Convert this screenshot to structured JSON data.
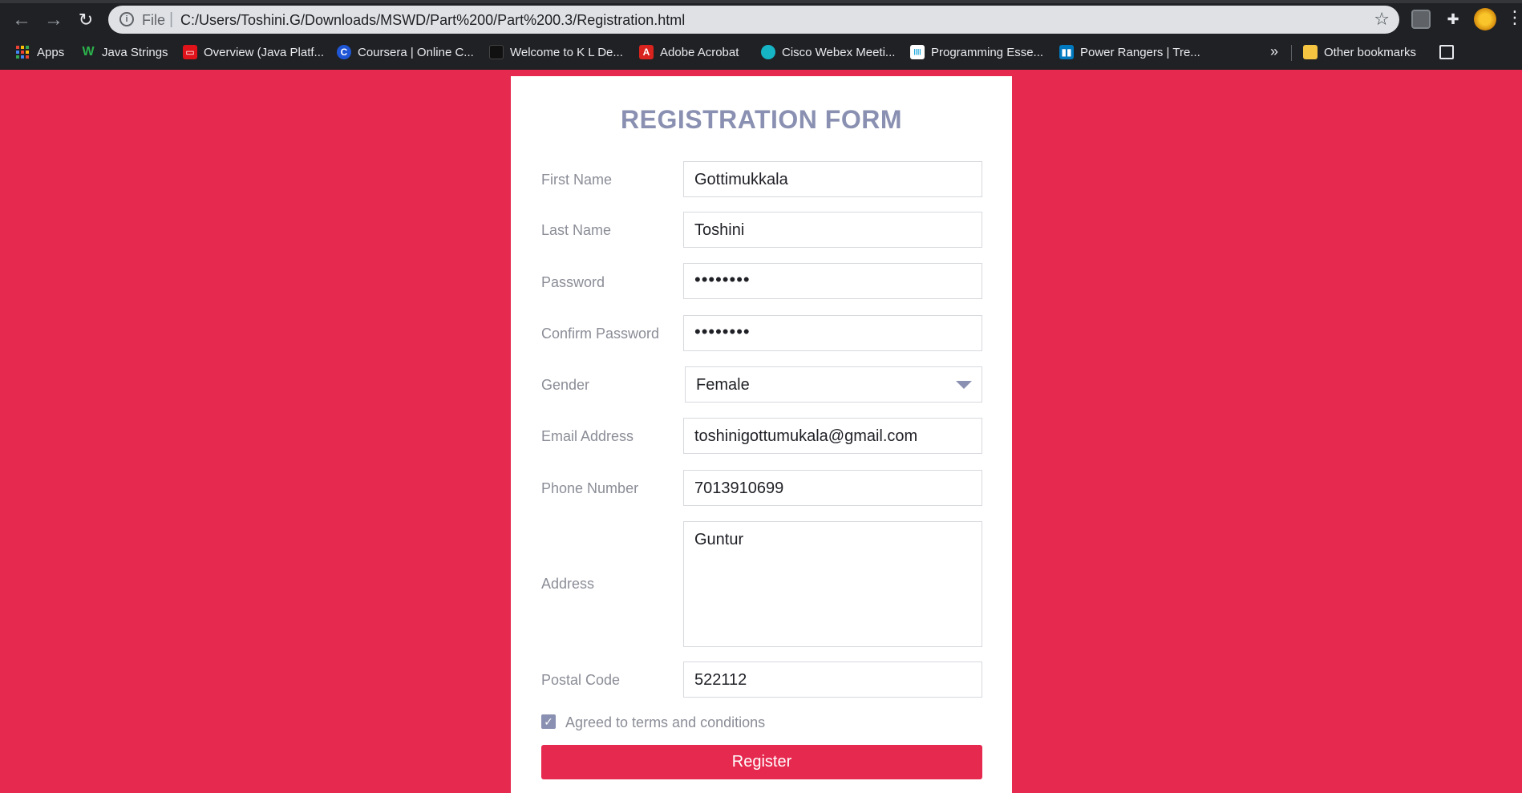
{
  "browser": {
    "scheme_label": "File",
    "separator": "|",
    "url": "C:/Users/Toshini.G/Downloads/MSWD/Part%200/Part%200.3/Registration.html",
    "bookmarks": [
      {
        "label": "Apps",
        "icon": "apps-grid-icon"
      },
      {
        "label": "Java Strings",
        "icon": "w-logo-icon",
        "color": "#2bb24c"
      },
      {
        "label": "Overview (Java Platf...",
        "icon": "oracle-icon",
        "color": "#e0121a"
      },
      {
        "label": "Coursera | Online C...",
        "icon": "coursera-icon",
        "color": "#1f56d6"
      },
      {
        "label": "Welcome to K L De...",
        "icon": "kl-icon",
        "color": "#202124"
      },
      {
        "label": "Adobe Acrobat",
        "icon": "acrobat-icon",
        "color": "#d9231e"
      },
      {
        "label": "Cisco Webex Meeti...",
        "icon": "webex-icon",
        "color": "#16b5c6"
      },
      {
        "label": "Programming Esse...",
        "icon": "cisco-icon",
        "color": "#ffffff"
      },
      {
        "label": "Power Rangers | Tre...",
        "icon": "trello-icon",
        "color": "#0079bf"
      }
    ],
    "more": "»",
    "other_bookmarks": "Other bookmarks"
  },
  "form": {
    "title": "REGISTRATION FORM",
    "fields": {
      "first_name": {
        "label": "First Name",
        "value": "Gottimukkala"
      },
      "last_name": {
        "label": "Last Name",
        "value": "Toshini"
      },
      "password": {
        "label": "Password",
        "value": "••••••••"
      },
      "confirm_password": {
        "label": "Confirm Password",
        "value": "••••••••"
      },
      "gender": {
        "label": "Gender",
        "value": "Female"
      },
      "email": {
        "label": "Email Address",
        "value": "toshinigottumukala@gmail.com"
      },
      "phone": {
        "label": "Phone Number",
        "value": "7013910699"
      },
      "address": {
        "label": "Address",
        "value": "Guntur"
      },
      "postal": {
        "label": "Postal Code",
        "value": "522112"
      }
    },
    "terms_label": "Agreed to terms and conditions",
    "terms_checked": true,
    "register_label": "Register"
  },
  "colors": {
    "background": "#e6294f",
    "accent": "#8a90b1"
  }
}
